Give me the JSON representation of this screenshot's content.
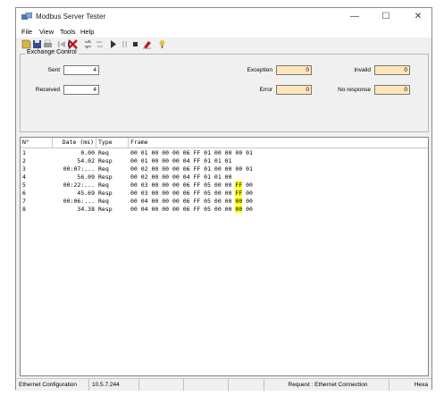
{
  "window": {
    "title": "Modbus Server Tester"
  },
  "controls": {
    "minimize": "—",
    "maximize": "☐",
    "close": "✕"
  },
  "menu": [
    "File",
    "View",
    "Tools",
    "Help"
  ],
  "toolbar_icons": [
    "new-icon",
    "save-icon",
    "print-icon",
    "step-back-icon",
    "stop-icon",
    "connect-icon",
    "disconnect-icon",
    "play-icon",
    "pause-icon",
    "stop-square-icon",
    "erase-icon",
    "help-icon"
  ],
  "exchange": {
    "label": "Exchange Control",
    "sent_label": "Sent",
    "sent": "4",
    "received_label": "Received",
    "received": "4",
    "exception_label": "Exception",
    "exception": "0",
    "error_label": "Error",
    "error": "0",
    "invalid_label": "Invalid",
    "invalid": "0",
    "noresponse_label": "No response",
    "noresponse": "0"
  },
  "columns": [
    "N°",
    "Date (ms)",
    "Type",
    "Frame"
  ],
  "rows": [
    {
      "n": "1",
      "date": "0.00",
      "type": "Req",
      "frame": "00 01 00 00 00 06 FF 01 00 00 00 01",
      "hl": ""
    },
    {
      "n": "2",
      "date": "54.02",
      "type": "Resp",
      "frame": "00 01 00 00 00 04 FF 01 01 01",
      "hl": ""
    },
    {
      "n": "3",
      "date": "00:07:...",
      "type": "Req",
      "frame": "00 02 00 00 00 06 FF 01 00 00 00 01",
      "hl": ""
    },
    {
      "n": "4",
      "date": "56.09",
      "type": "Resp",
      "frame": "00 02 00 00 00 04 FF 01 01 00",
      "hl": ""
    },
    {
      "n": "5",
      "date": "00:22:...",
      "type": "Req",
      "frame": "00 03 00 00 00 06 FF 05 00 00 ",
      "hl": "FF",
      "tail": " 00"
    },
    {
      "n": "6",
      "date": "45.69",
      "type": "Resp",
      "frame": "00 03 00 00 00 06 FF 05 00 00 ",
      "hl": "FF",
      "tail": " 00"
    },
    {
      "n": "7",
      "date": "00:06:...",
      "type": "Req",
      "frame": "00 04 00 00 00 06 FF 05 00 00 ",
      "hl": "00",
      "tail": " 00"
    },
    {
      "n": "8",
      "date": "34.38",
      "type": "Resp",
      "frame": "00 04 00 00 00 06 FF 05 00 00 ",
      "hl": "00",
      "tail": " 00"
    }
  ],
  "status": {
    "config": "Ethernet Configuration",
    "ip": "10.5.7.244",
    "mode": "Request : Ethernet Connection",
    "keys": "Hexa"
  },
  "colors": {
    "highlight": "#ffff00",
    "counter_orange": "#ffe6b8"
  }
}
